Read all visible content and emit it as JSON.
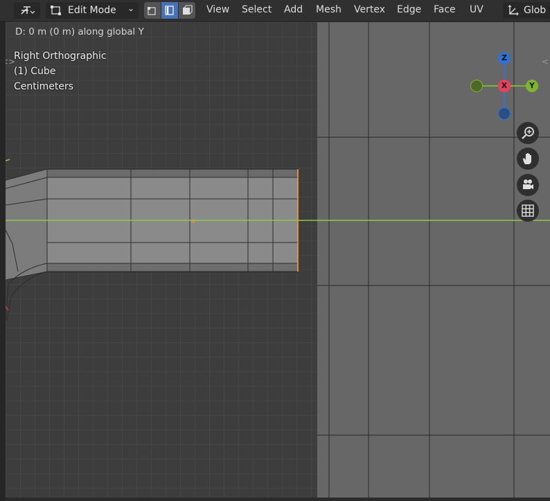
{
  "header": {
    "editor_icon": "transform-tool-icon",
    "mode_label": "Edit Mode",
    "select_modes": [
      "vertex-select-icon",
      "edge-select-icon",
      "face-select-icon"
    ],
    "menus": [
      "View",
      "Select",
      "Add",
      "Mesh",
      "Vertex",
      "Edge",
      "Face",
      "UV"
    ],
    "orientation_label": "Glob"
  },
  "status": {
    "operation_text": "D: 0 m (0 m) along global Y"
  },
  "viewport": {
    "view_name": "Right Orthographic",
    "object_name": "(1) Cube",
    "units": "Centimeters"
  },
  "gizmo": {
    "z_label": "Z",
    "x_label": "X",
    "y_label": "Y",
    "colors": {
      "z": "#2f72d3",
      "x": "#e8405b",
      "y": "#7fb52c"
    }
  },
  "nav_buttons": [
    "zoom-icon",
    "hand-pan-icon",
    "camera-icon",
    "grid-icon"
  ]
}
